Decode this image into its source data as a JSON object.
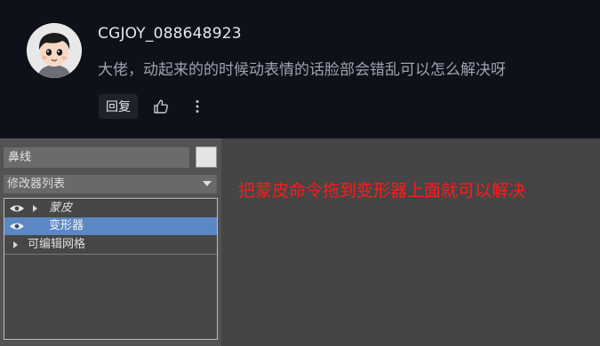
{
  "comment": {
    "username": "CGJOY_088648923",
    "text": "大佬，动起来的的时候动表情的话脸部会错乱可以怎么解决呀",
    "reply_label": "回复",
    "avatar_icon": "cartoon-avatar",
    "like_icon": "thumbs-up-icon",
    "more_icon": "vertical-dots-icon"
  },
  "embedded": {
    "object_name": "鼻线",
    "modifier_list_label": "修改器列表",
    "modifiers": [
      {
        "label": "蒙皮",
        "italic": true,
        "visible": true,
        "expandable": true,
        "selected": false
      },
      {
        "label": "变形器",
        "italic": false,
        "visible": true,
        "expandable": false,
        "selected": true
      },
      {
        "label": "可编辑网格",
        "italic": false,
        "visible": false,
        "expandable": true,
        "selected": false
      }
    ],
    "answer_text": "把蒙皮命令拖到变形器上面就可以解决"
  },
  "colors": {
    "page_bg": "#0e1119",
    "panel_bg": "#535353",
    "selected_row": "#5b87c4",
    "answer_text": "#ff1a1a"
  }
}
